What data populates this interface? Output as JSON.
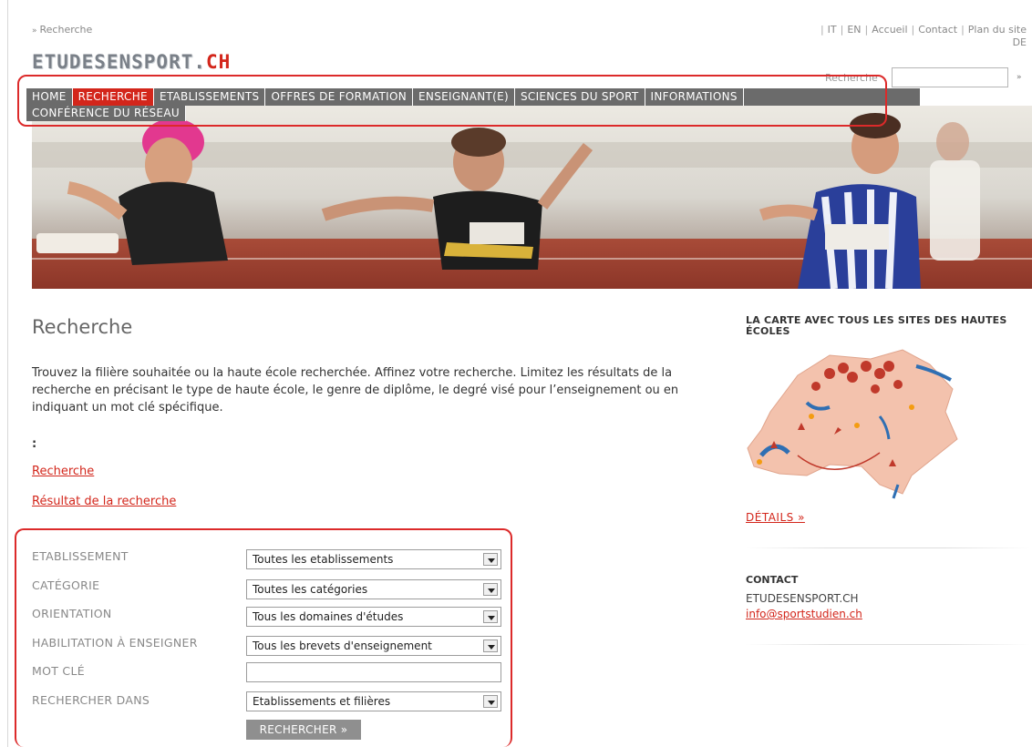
{
  "breadcrumb": {
    "mark": "»",
    "label": "Recherche"
  },
  "top_links": {
    "it": "IT",
    "en": "EN",
    "home": "Accueil",
    "contact": "Contact",
    "sitemap": "Plan du site",
    "de": "DE"
  },
  "logo": {
    "part1": "ETUDESENSPORT.",
    "part2": "CH"
  },
  "search": {
    "label": "Recherche",
    "placeholder": "",
    "go": "»"
  },
  "nav": {
    "row1": [
      {
        "label": "HOME"
      },
      {
        "label": "RECHERCHE",
        "active": true
      },
      {
        "label": "ETABLISSEMENTS"
      },
      {
        "label": "OFFRES DE FORMATION"
      },
      {
        "label": "ENSEIGNANT(E)"
      },
      {
        "label": "SCIENCES DU SPORT"
      },
      {
        "label": "INFORMATIONS"
      }
    ],
    "row2": [
      {
        "label": "CONFÉRENCE DU RÉSEAU"
      }
    ]
  },
  "main": {
    "title": "Recherche",
    "intro": "Trouvez la filière souhaitée ou la haute école recherchée. Affinez votre recherche. Limitez les résultats de la recherche en précisant le type de haute école, le genre de diplôme, le degré visé pour l’enseignement ou en indiquant un mot clé spécifique.",
    "colon": ":",
    "link_search": "Recherche",
    "link_results": "Résultat de la recherche"
  },
  "form": {
    "fields": [
      {
        "label": "ETABLISSEMENT",
        "value": "Toutes les etablissements"
      },
      {
        "label": "CATÉGORIE",
        "value": "Toutes les catégories"
      },
      {
        "label": "ORIENTATION",
        "value": "Tous les domaines d'études"
      },
      {
        "label": "HABILITATION À ENSEIGNER",
        "value": "Tous les brevets d'enseignement"
      },
      {
        "label": "MOT CLÉ",
        "value": ""
      },
      {
        "label": "RECHERCHER DANS",
        "value": "Etablissements et filières"
      }
    ],
    "submit": "RECHERCHER »"
  },
  "sidebar": {
    "map_heading": "LA CARTE AVEC TOUS LES SITES DES HAUTES ÉCOLES",
    "details": "DÉTAILS »",
    "contact_heading": "CONTACT",
    "contact_org": "ETUDESENSPORT.CH",
    "contact_email": "info@sportstudien.ch"
  },
  "colors": {
    "accent": "#d3261b",
    "nav_bg": "#6b6b6b",
    "highlight": "#dc2a2a"
  }
}
